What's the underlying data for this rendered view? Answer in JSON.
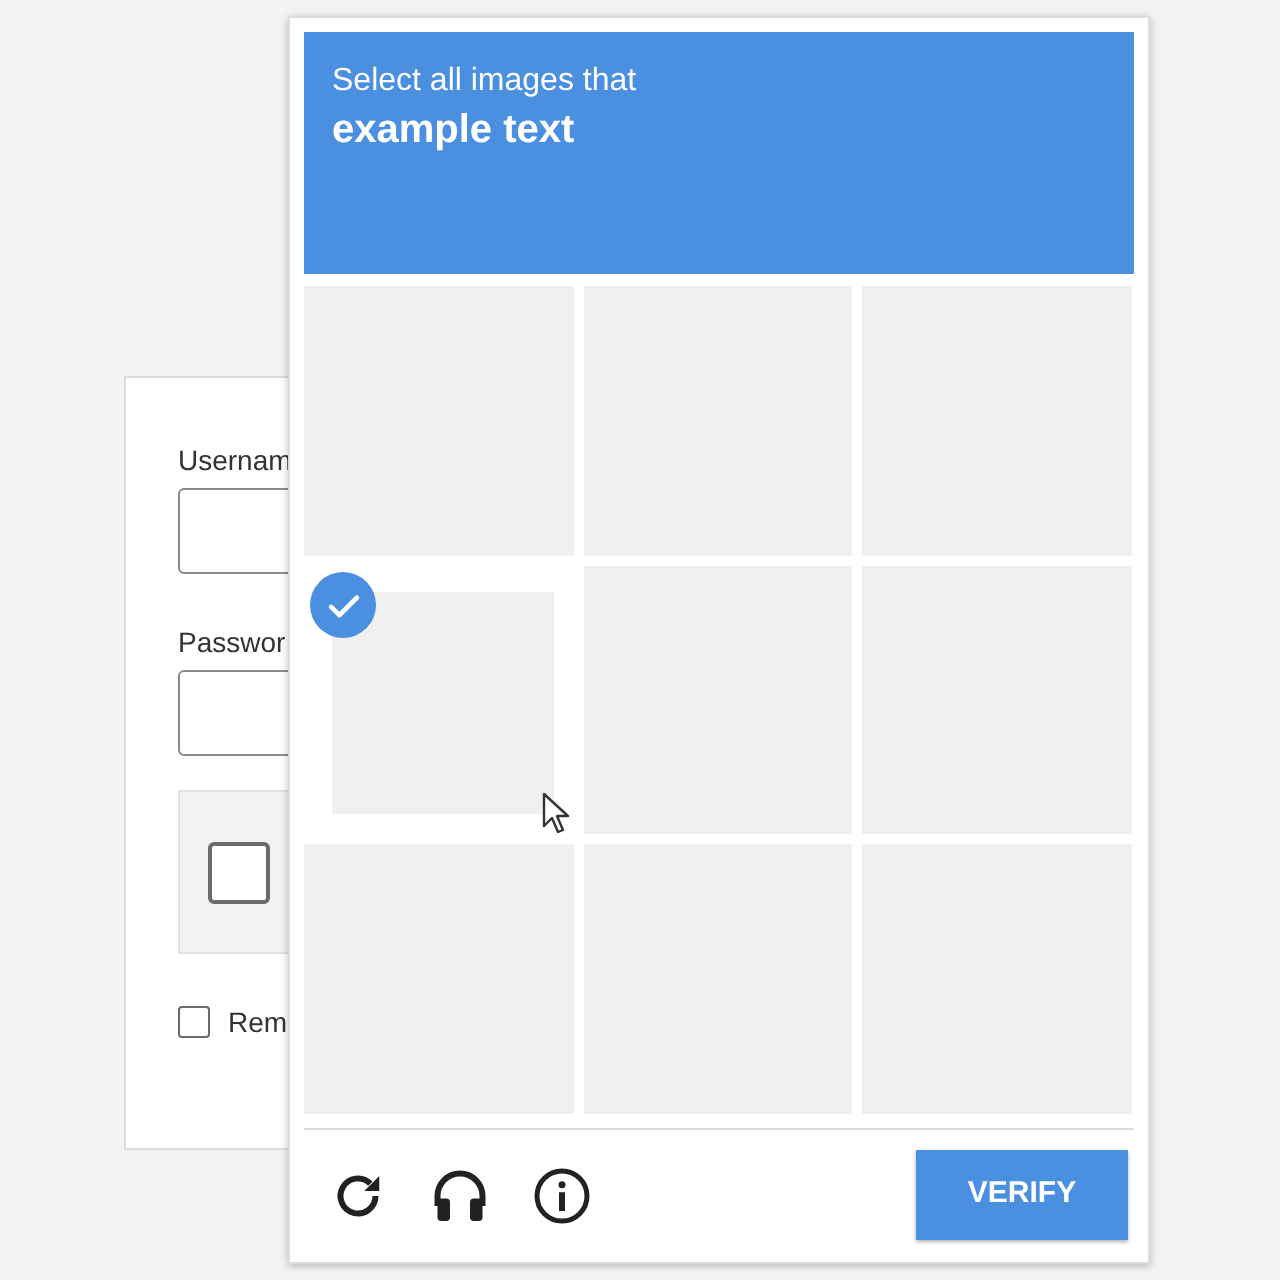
{
  "login": {
    "fields": [
      {
        "label": "Usernam"
      },
      {
        "label": "Passwor"
      }
    ],
    "captcha_checkbox": {
      "checked": false
    },
    "remember": {
      "label": "Rem",
      "checked": false
    }
  },
  "captcha": {
    "instruction": "Select all images that",
    "target": "example text",
    "tiles": [
      {
        "selected": false
      },
      {
        "selected": false
      },
      {
        "selected": false
      },
      {
        "selected": true
      },
      {
        "selected": false
      },
      {
        "selected": false
      },
      {
        "selected": false
      },
      {
        "selected": false
      },
      {
        "selected": false
      }
    ],
    "verify_button": "VERIFY"
  }
}
